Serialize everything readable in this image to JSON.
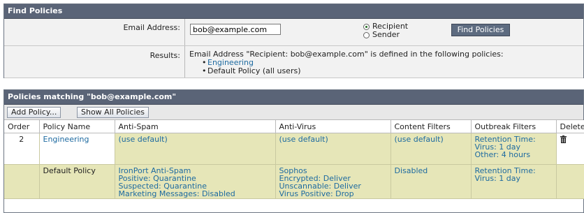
{
  "find_panel": {
    "title": "Find Policies",
    "email_label": "Email Address:",
    "email_value": "bob@example.com",
    "radio_recipient": "Recipient",
    "radio_sender": "Sender",
    "selected_radio": "Recipient",
    "find_button": "Find Policies",
    "results_label": "Results:",
    "results_text": "Email Address \"Recipient: bob@example.com\" is defined in the following policies:",
    "results_policies": [
      "Engineering",
      "Default Policy (all users)"
    ]
  },
  "match_panel": {
    "title": "Policies matching \"bob@example.com\"",
    "add_button": "Add Policy...",
    "show_all_button": "Show All Policies",
    "columns": [
      "Order",
      "Policy Name",
      "Anti-Spam",
      "Anti-Virus",
      "Content Filters",
      "Outbreak Filters",
      "Delete"
    ],
    "rows": [
      {
        "order": "2",
        "policy_name": "Engineering",
        "anti_spam": [
          "(use default)"
        ],
        "anti_virus": [
          "(use default)"
        ],
        "content_filters": "(use default)",
        "outbreak_filters": [
          "Retention Time:",
          "Virus: 1 day",
          "Other: 4 hours"
        ],
        "delete_icon": "trash-icon"
      },
      {
        "order": "",
        "policy_name": "Default Policy",
        "anti_spam": [
          "IronPort Anti-Spam",
          "Positive: Quarantine",
          "Suspected: Quarantine",
          "Marketing Messages: Disabled"
        ],
        "anti_virus": [
          "Sophos",
          "Encrypted: Deliver",
          "Unscannable: Deliver",
          "Virus Positive: Drop"
        ],
        "content_filters": "Disabled",
        "outbreak_filters": [
          "Retention Time:",
          "Virus: 1 day"
        ],
        "delete_icon": ""
      }
    ]
  },
  "colors": {
    "header_bg": "#5a6477",
    "row_bg": "#e6e6b8",
    "link": "#1d6aa0"
  }
}
